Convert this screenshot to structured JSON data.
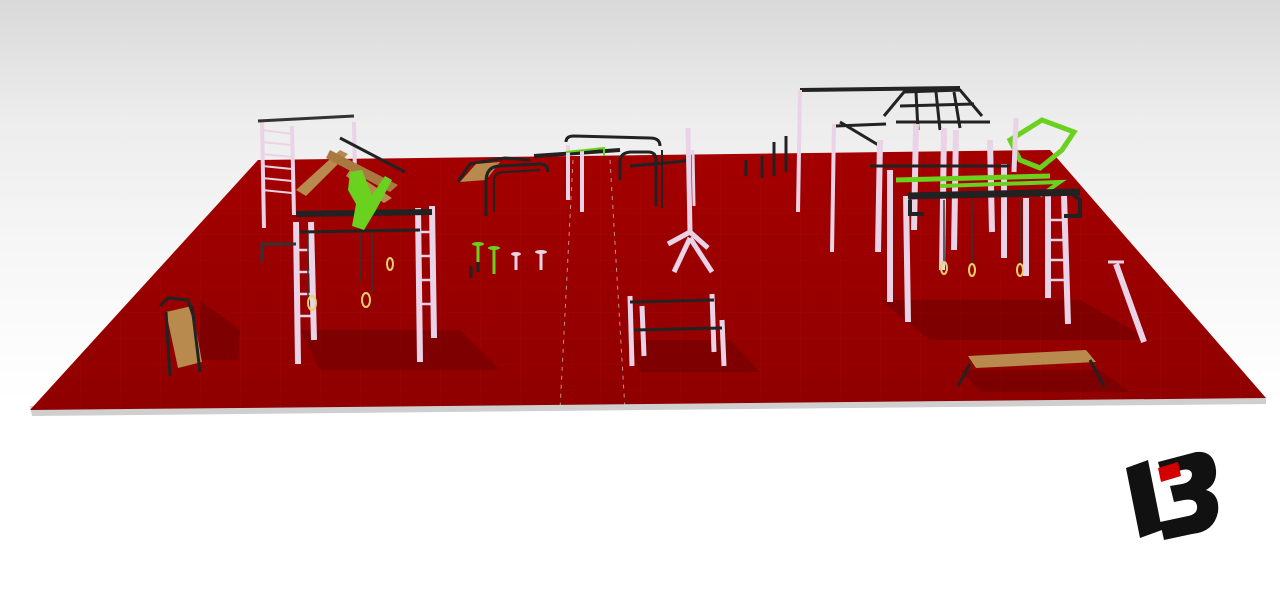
{
  "scene": {
    "floor_color": "#9c0000",
    "floor_edge_color": "#c8c8c8",
    "frame_color": "#e8c8e0",
    "bar_color": "#222222",
    "accent_color": "#6ad21e",
    "wood_color": "#b88a4e"
  },
  "logo": {
    "icon": "i3-logo-icon",
    "primary_color": "#111111",
    "accent_color": "#d40000"
  }
}
